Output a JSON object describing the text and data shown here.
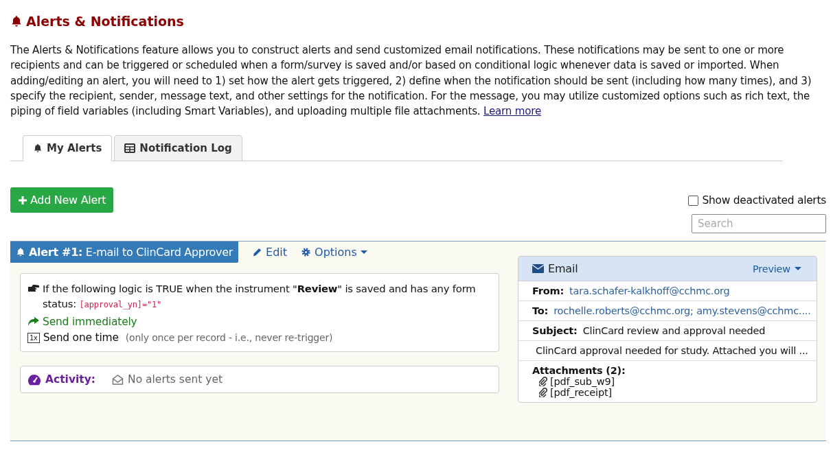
{
  "page": {
    "title": "Alerts & Notifications",
    "intro": "The Alerts & Notifications feature allows you to construct alerts and send customized email notifications. These notifications may be sent to one or more recipients and can be triggered or scheduled when a form/survey is saved and/or based on conditional logic whenever data is saved or imported. When adding/editing an alert, you will need to 1) set how the alert gets triggered, 2) define when the notification should be sent (including how many times), and 3) specify the recipient, sender, message text, and other settings for the notification. For the message, you may utilize customized options such as rich text, the piping of field variables (including Smart Variables), and uploading multiple file attachments.",
    "learn_more": "Learn more"
  },
  "tabs": [
    {
      "label": "My Alerts",
      "kind": "bell",
      "selected": true
    },
    {
      "label": "Notification Log",
      "kind": "table",
      "selected": false
    }
  ],
  "add_button": "Add New Alert",
  "show_deactivated": {
    "label": "Show deactivated alerts",
    "checked": false
  },
  "search": {
    "placeholder": "Search"
  },
  "alert": {
    "number": "Alert #1:",
    "name": "E-mail to ClinCard Approver",
    "edit": "Edit",
    "options": "Options",
    "condition": "If the following logic is TRUE when the instrument \"**Review**\" is saved and has any form status:",
    "logic": "[approval_yn]=\"1\"",
    "send_when": "Send immediately",
    "repeat_badge": "1x",
    "repeat": "Send one time",
    "repeat_note": "(only once per record - i.e., never re-trigger)",
    "activity_label": "Activity:",
    "activity": "No alerts sent yet",
    "email": {
      "title": "Email",
      "preview": "Preview",
      "from_label": "From:",
      "from": "tara.schafer-kalkhoff@cchmc.org",
      "to_label": "To:",
      "to": "rochelle.roberts@cchmc.org; amy.stevens@cchmc....",
      "subject_label": "Subject:",
      "subject": "ClinCard review and approval needed",
      "body": "ClinCard approval needed for study. Attached you will ...",
      "attachments_label": "Attachments (2):",
      "attachments": [
        "[pdf_sub_w9]",
        "[pdf_receipt]"
      ]
    }
  }
}
